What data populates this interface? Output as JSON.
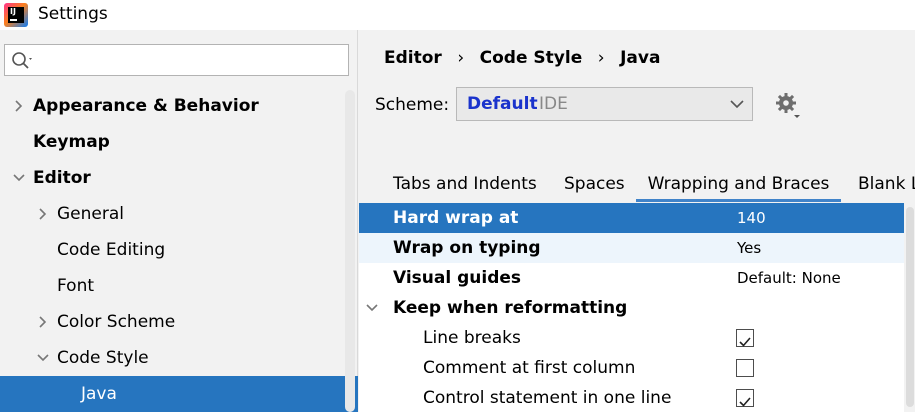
{
  "window": {
    "title": "Settings",
    "app_icon_text": "IJ"
  },
  "search": {
    "placeholder": ""
  },
  "sidebar": {
    "items": [
      {
        "label": "Appearance & Behavior",
        "expanded": false
      },
      {
        "label": "Keymap"
      },
      {
        "label": "Editor",
        "expanded": true
      },
      {
        "label": "General",
        "expanded": false
      },
      {
        "label": "Code Editing"
      },
      {
        "label": "Font"
      },
      {
        "label": "Color Scheme",
        "expanded": false
      },
      {
        "label": "Code Style",
        "expanded": true
      },
      {
        "label": "Java",
        "selected": true
      }
    ]
  },
  "breadcrumb": [
    "Editor",
    "Code Style",
    "Java"
  ],
  "scheme": {
    "label": "Scheme:",
    "name": "Default",
    "kind": "IDE"
  },
  "tabs": [
    {
      "label": "Tabs and Indents"
    },
    {
      "label": "Spaces"
    },
    {
      "label": "Wrapping and Braces",
      "active": true
    },
    {
      "label": "Blank Li"
    }
  ],
  "settings": [
    {
      "label": "Hard wrap at",
      "value": "140",
      "selected": true
    },
    {
      "label": "Wrap on typing",
      "value": "Yes"
    },
    {
      "label": "Visual guides",
      "value": "Default: None"
    },
    {
      "label": "Keep when reformatting",
      "group": true,
      "expanded": true
    },
    {
      "label": "Line breaks",
      "checked": true
    },
    {
      "label": "Comment at first column",
      "checked": false
    },
    {
      "label": "Control statement in one line",
      "checked": true
    }
  ],
  "colors": {
    "selection": "#2675bf",
    "accent_link": "#1a33cc",
    "tab_underline": "#4083c9"
  }
}
